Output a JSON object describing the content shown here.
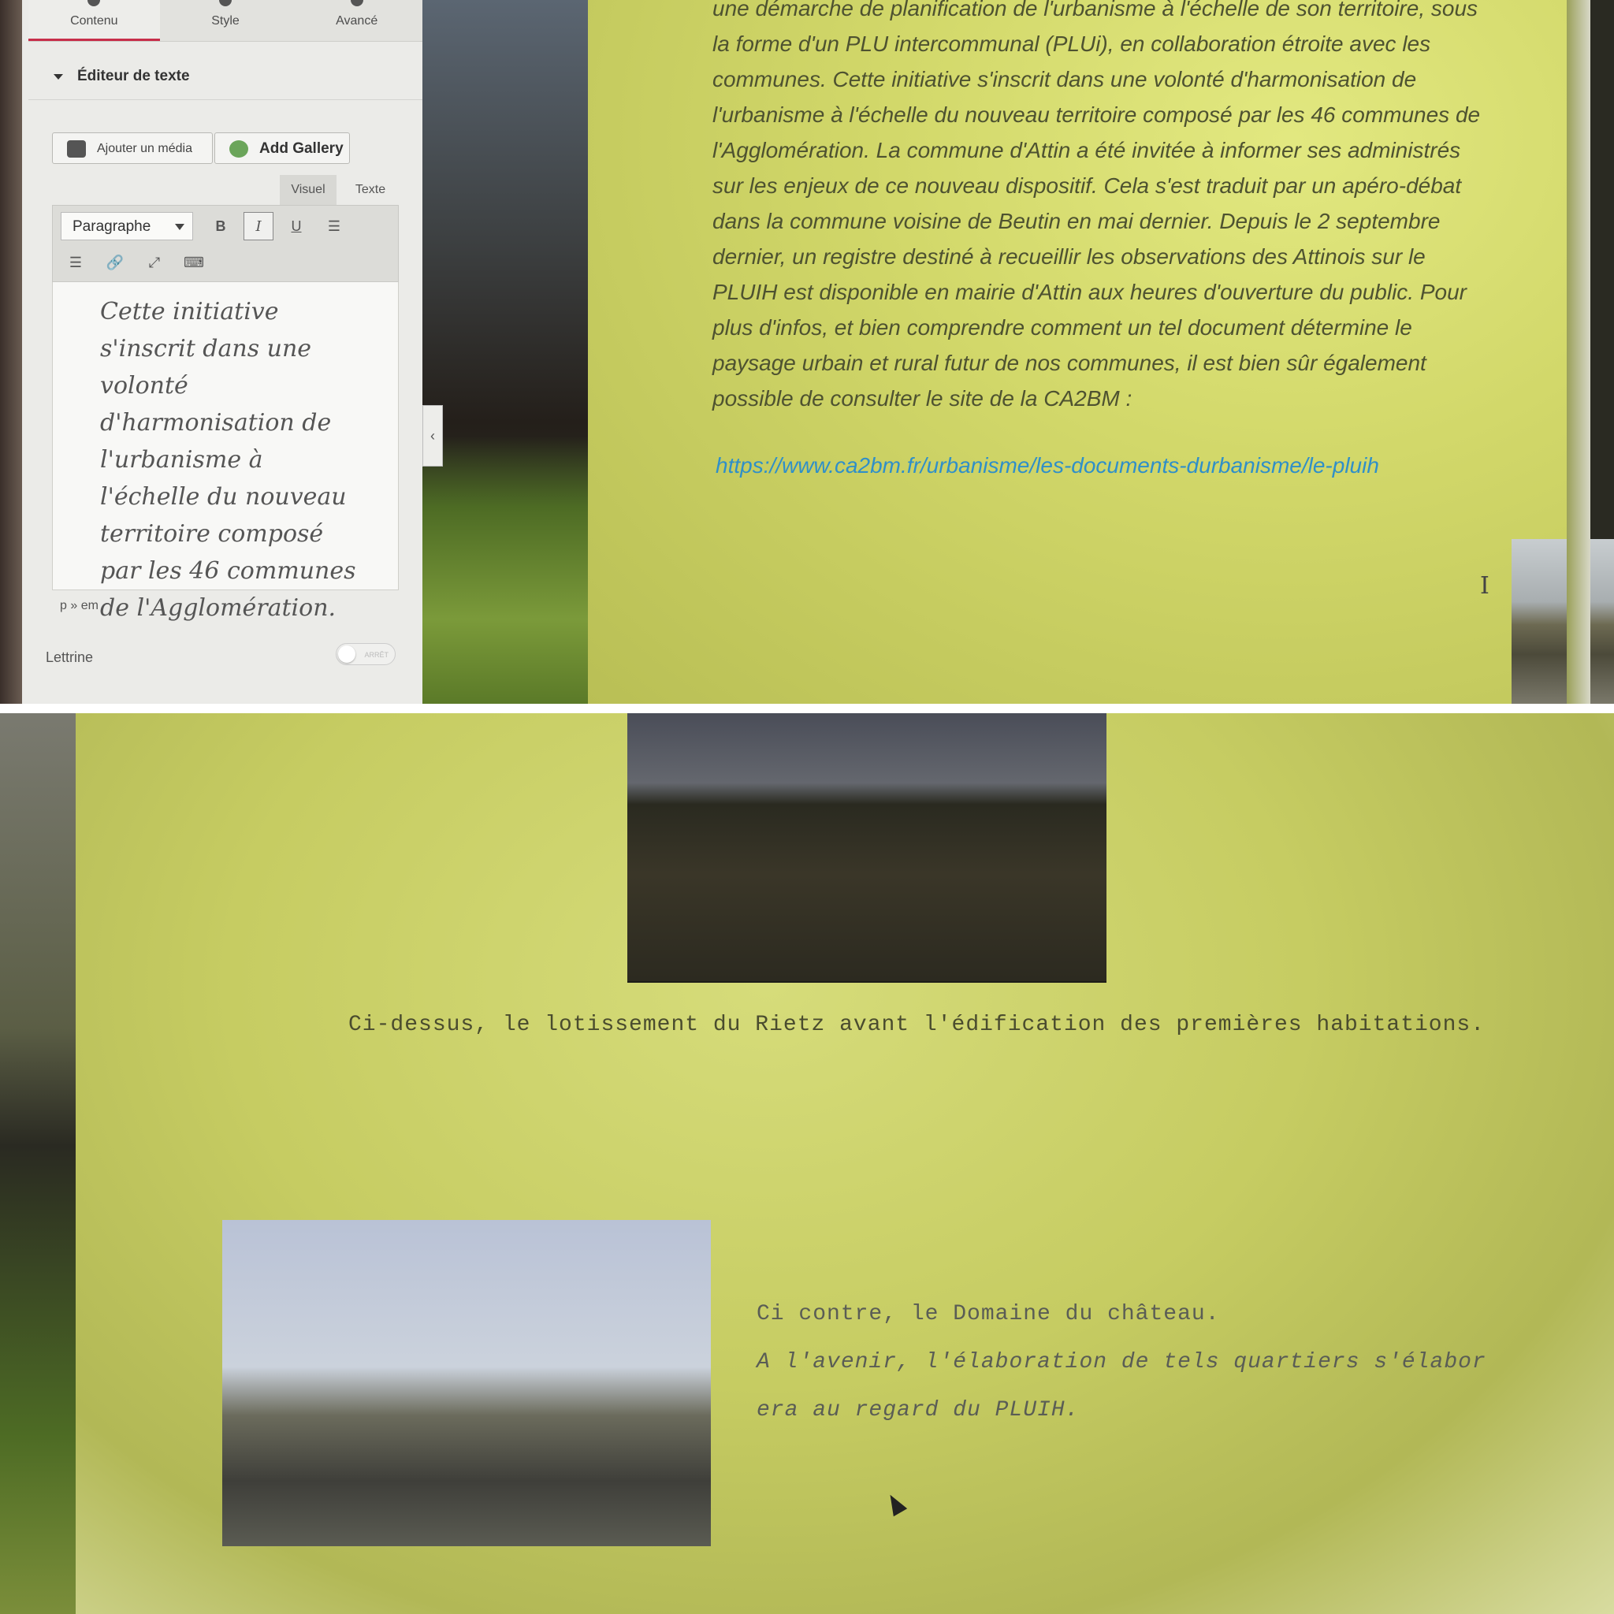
{
  "sidebar": {
    "tabs": [
      {
        "label": "Contenu"
      },
      {
        "label": "Style"
      },
      {
        "label": "Avancé"
      }
    ],
    "section_title": "Éditeur de texte",
    "add_media_label": "Ajouter un média",
    "add_gallery_label": "Add Gallery",
    "mode_tabs": {
      "visual": "Visuel",
      "text": "Texte"
    },
    "format_select_value": "Paragraphe",
    "toolbar": {
      "bold": "B",
      "italic": "I",
      "underline": "U"
    },
    "editor_text": "Cette initiative s'inscrit dans une volonté d'harmonisation de l'urbanisme à l'échelle du nouveau territoire composé par les 46 communes de l'Agglomération.",
    "element_path": "p » em",
    "lettrine_label": "Lettrine",
    "lettrine_toggle_text": "ARRÊT"
  },
  "article": {
    "body_text": "une démarche de planification de l'urbanisme à l'échelle de son territoire, sous la forme d'un PLU intercommunal (PLUi), en collaboration étroite avec les communes. Cette initiative s'inscrit dans une volonté d'harmonisation de l'urbanisme à l'échelle du nouveau territoire composé par les 46 communes de l'Agglomération.  La commune d'Attin a été invitée à informer ses administrés sur les enjeux  de ce nouveau dispositif. Cela s'est traduit par un apéro-débat dans la commune voisine de Beutin en mai dernier. Depuis le 2 septembre dernier, un registre destiné à recueillir les observations des Attinois sur le PLUIH est disponible en mairie d'Attin aux heures d'ouverture du public. Pour plus d'infos, et bien comprendre comment un tel document détermine le paysage urbain et rural futur de nos communes, il est bien sûr également possible de consulter le site de la CA2BM :",
    "link": "https://www.ca2bm.fr/urbanisme/les-documents-durbanisme/le-pluih",
    "caption_rietz": "Ci-dessus, le lotissement du Rietz avant l'édification des premières habitations.",
    "caption_domaine_1": "Ci contre, le Domaine du château.",
    "caption_domaine_2": "A l'avenir, l'élaboration de tels quartiers s'élabor",
    "caption_domaine_3": "era au regard du PLUIH."
  },
  "icons": {
    "media": "camera-music-icon",
    "gallery": "gallery-grid-icon",
    "list_bullet": "bullet-list-icon",
    "list_number": "numbered-list-icon",
    "link": "link-icon",
    "fullscreen": "fullscreen-icon",
    "keyboard": "keyboard-icon",
    "collapse": "chevron-left-icon"
  },
  "colors": {
    "active_tab_underline": "#c72e4a",
    "link": "#2f8fc9",
    "page_background": "#d2d86a"
  }
}
